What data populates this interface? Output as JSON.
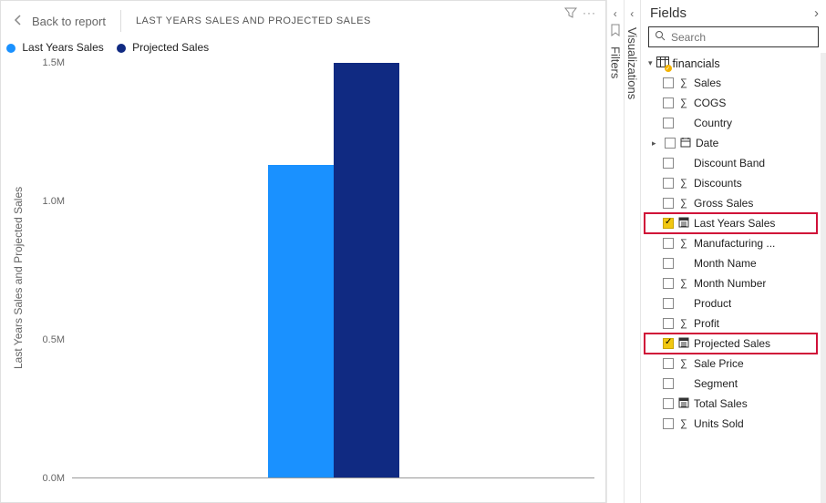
{
  "header": {
    "back_label": "Back to report",
    "title": "LAST YEARS SALES AND PROJECTED SALES"
  },
  "legend": {
    "items": [
      {
        "label": "Last Years Sales",
        "color": "#1a91ff"
      },
      {
        "label": "Projected Sales",
        "color": "#102a82"
      }
    ]
  },
  "yaxis": {
    "label": "Last Years Sales and Projected Sales",
    "ticks": [
      "1.5M",
      "1.0M",
      "0.5M",
      "0.0M"
    ]
  },
  "chart_data": {
    "type": "bar",
    "title": "Last Years Sales and Projected Sales",
    "ylabel": "Last Years Sales and Projected Sales",
    "xlabel": "",
    "ylim": [
      0,
      1500000
    ],
    "categories": [
      ""
    ],
    "series": [
      {
        "name": "Last Years Sales",
        "color": "#1a91ff",
        "values": [
          1130000
        ]
      },
      {
        "name": "Projected Sales",
        "color": "#102a82",
        "values": [
          1500000
        ]
      }
    ]
  },
  "panes": {
    "filters_label": "Filters",
    "viz_label": "Visualizations",
    "fields_label": "Fields",
    "search_placeholder": "Search"
  },
  "fields": {
    "table": "financials",
    "items": [
      {
        "name": "Sales",
        "icon": "sum",
        "checked": false
      },
      {
        "name": "COGS",
        "icon": "sum",
        "checked": false
      },
      {
        "name": "Country",
        "icon": "",
        "checked": false
      },
      {
        "name": "Date",
        "icon": "date",
        "checked": false,
        "expandable": true
      },
      {
        "name": "Discount Band",
        "icon": "",
        "checked": false
      },
      {
        "name": "Discounts",
        "icon": "sum",
        "checked": false
      },
      {
        "name": "Gross Sales",
        "icon": "sum",
        "checked": false
      },
      {
        "name": "Last Years Sales",
        "icon": "measure",
        "checked": true,
        "highlight": true
      },
      {
        "name": "Manufacturing ...",
        "icon": "sum",
        "checked": false
      },
      {
        "name": "Month Name",
        "icon": "",
        "checked": false
      },
      {
        "name": "Month Number",
        "icon": "sum",
        "checked": false
      },
      {
        "name": "Product",
        "icon": "",
        "checked": false
      },
      {
        "name": "Profit",
        "icon": "sum",
        "checked": false
      },
      {
        "name": "Projected Sales",
        "icon": "measure",
        "checked": true,
        "highlight": true
      },
      {
        "name": "Sale Price",
        "icon": "sum",
        "checked": false
      },
      {
        "name": "Segment",
        "icon": "",
        "checked": false
      },
      {
        "name": "Total Sales",
        "icon": "measure",
        "checked": false
      },
      {
        "name": "Units Sold",
        "icon": "sum",
        "checked": false
      }
    ]
  }
}
